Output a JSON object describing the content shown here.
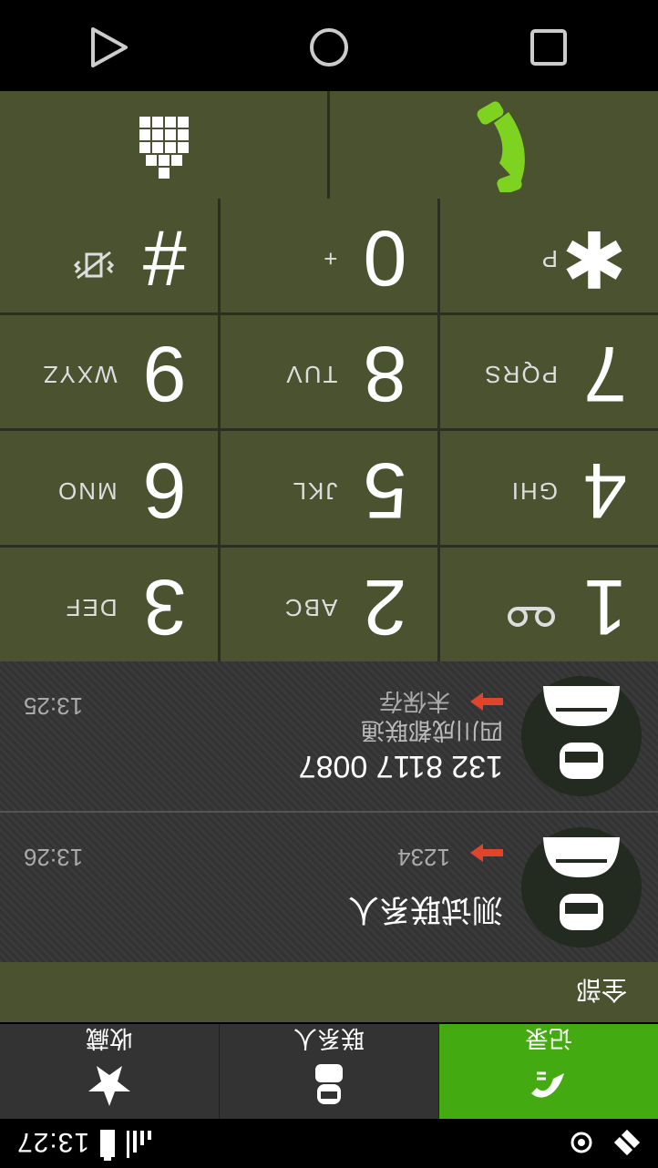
{
  "status_bar": {
    "time": "13:27",
    "icons": [
      "signal-icon",
      "battery-icon",
      "sync-icon",
      "satellite-icon"
    ]
  },
  "tabs": [
    {
      "label": "记录",
      "icon": "call-log-icon",
      "active": true
    },
    {
      "label": "联系人",
      "icon": "contacts-icon",
      "active": false
    },
    {
      "label": "收藏",
      "icon": "star-icon",
      "active": false
    }
  ],
  "filter": {
    "label": "全部"
  },
  "call_log": [
    {
      "name": "测试联系人",
      "number_detail": "1234",
      "time": "13:26",
      "sub": ""
    },
    {
      "name": "132 8117 0087",
      "number_detail": "未保存",
      "time": "13:25",
      "sub": "四川成都联通"
    }
  ],
  "keypad": [
    {
      "digit": "1",
      "letters": "",
      "icon": "voicemail-icon"
    },
    {
      "digit": "2",
      "letters": "ABC"
    },
    {
      "digit": "3",
      "letters": "DEF"
    },
    {
      "digit": "4",
      "letters": "GHI"
    },
    {
      "digit": "5",
      "letters": "JKL"
    },
    {
      "digit": "6",
      "letters": "MNO"
    },
    {
      "digit": "7",
      "letters": "PQRS"
    },
    {
      "digit": "8",
      "letters": "TUV"
    },
    {
      "digit": "9",
      "letters": "WXYZ"
    },
    {
      "digit": "✱",
      "letters": "P"
    },
    {
      "digit": "0",
      "letters": "+"
    },
    {
      "digit": "#",
      "letters": "",
      "icon": "vibrate-off-icon"
    }
  ],
  "actions": {
    "call": "call-icon",
    "dialpad": "dialpad-icon"
  },
  "colors": {
    "accent": "#44aa11",
    "panel": "#4a5230",
    "call_green": "#7ed321",
    "missed_red": "#e0442a"
  }
}
